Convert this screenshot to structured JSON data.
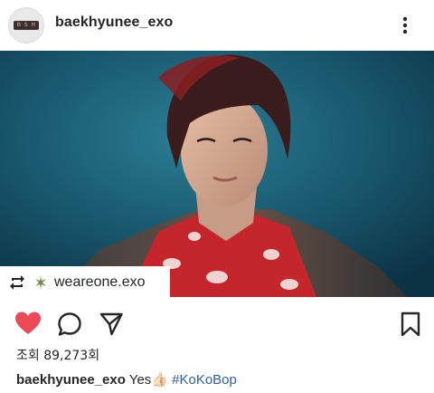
{
  "post": {
    "username": "baekhyunee_exo",
    "avatar_badge": [
      "B",
      "S",
      "H"
    ],
    "repost": {
      "source_user": "weareone.exo"
    },
    "views_label": "조회",
    "views_count": "89,273회",
    "caption": {
      "username": "baekhyunee_exo",
      "text": "Yes👍🏻",
      "hashtag": "#KoKoBop"
    },
    "liked": true
  },
  "colors": {
    "like_red": "#ed4956",
    "hashtag_blue": "#2f5f96",
    "photo_bg": "#1a5e73"
  },
  "icons": [
    "more-icon",
    "repost-icon",
    "weareone-logo-icon",
    "heart-icon",
    "comment-icon",
    "share-icon",
    "bookmark-icon"
  ]
}
